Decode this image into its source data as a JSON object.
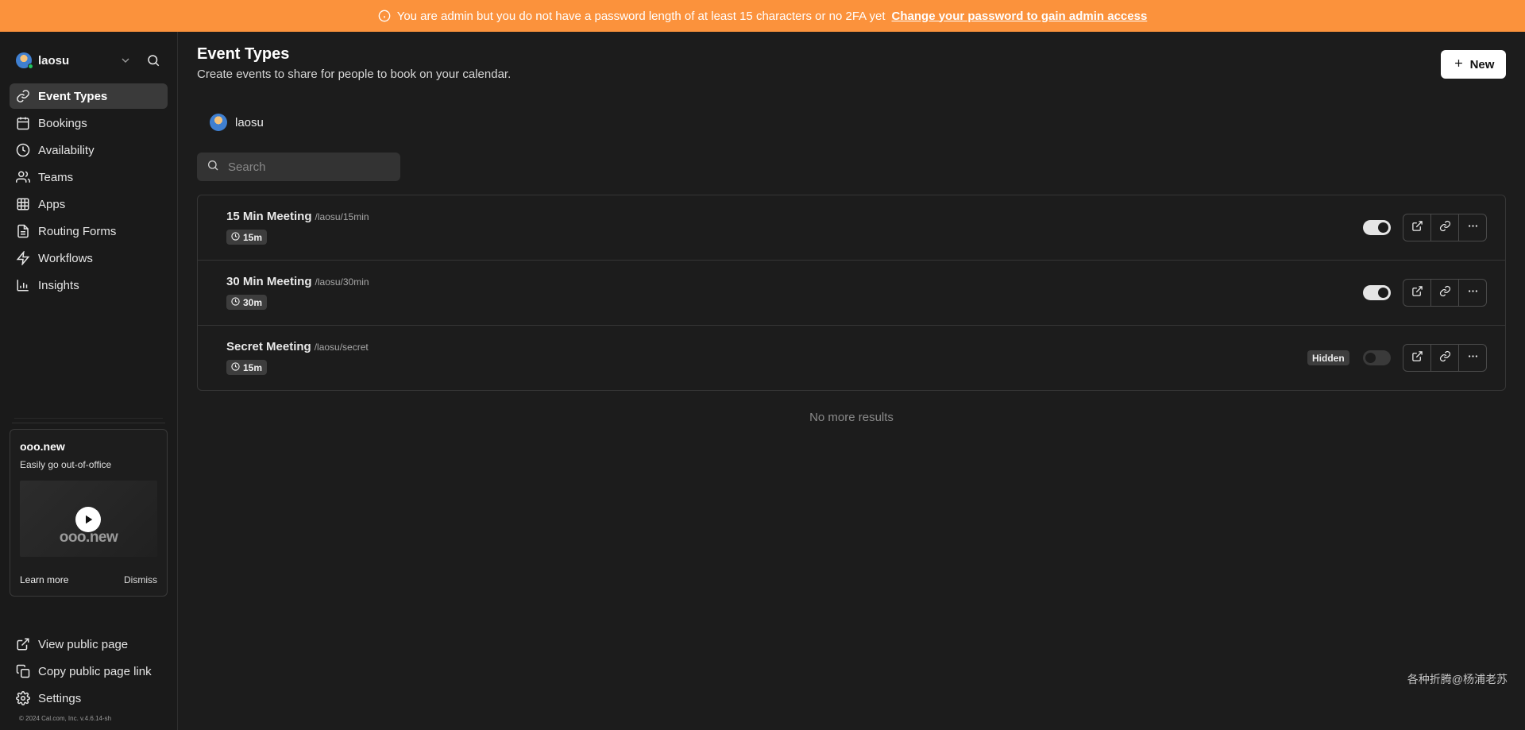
{
  "banner": {
    "message": "You are admin but you do not have a password length of at least 15 characters or no 2FA yet",
    "link_text": "Change your password to gain admin access",
    "bg_color": "#fb923c"
  },
  "sidebar": {
    "user_name": "laosu",
    "items": [
      {
        "label": "Event Types",
        "icon": "link-icon",
        "active": true
      },
      {
        "label": "Bookings",
        "icon": "calendar-icon"
      },
      {
        "label": "Availability",
        "icon": "clock-icon"
      },
      {
        "label": "Teams",
        "icon": "users-icon"
      },
      {
        "label": "Apps",
        "icon": "grid-icon"
      },
      {
        "label": "Routing Forms",
        "icon": "file-text-icon"
      },
      {
        "label": "Workflows",
        "icon": "zap-icon"
      },
      {
        "label": "Insights",
        "icon": "bar-chart-icon"
      }
    ],
    "promo": {
      "title": "ooo.new",
      "subtitle": "Easily go out-of-office",
      "video_wordmark": "ooo.new",
      "learn_more": "Learn more",
      "dismiss": "Dismiss"
    },
    "footer": [
      {
        "label": "View public page",
        "icon": "external-link-icon"
      },
      {
        "label": "Copy public page link",
        "icon": "copy-icon"
      },
      {
        "label": "Settings",
        "icon": "gear-icon"
      }
    ],
    "copyright": "© 2024 Cal.com, Inc. v.4.6.14-sh"
  },
  "main": {
    "title": "Event Types",
    "subtitle": "Create events to share for people to book on your calendar.",
    "new_button": "New",
    "profile_name": "laosu",
    "search_placeholder": "Search",
    "events": [
      {
        "title": "15 Min Meeting",
        "slug": "/laosu/15min",
        "duration": "15m",
        "enabled": true,
        "hidden": false
      },
      {
        "title": "30 Min Meeting",
        "slug": "/laosu/30min",
        "duration": "30m",
        "enabled": true,
        "hidden": false
      },
      {
        "title": "Secret Meeting",
        "slug": "/laosu/secret",
        "duration": "15m",
        "enabled": false,
        "hidden": true,
        "hidden_label": "Hidden"
      }
    ],
    "no_more_results": "No more results"
  },
  "watermark": "各种折腾@杨浦老苏"
}
